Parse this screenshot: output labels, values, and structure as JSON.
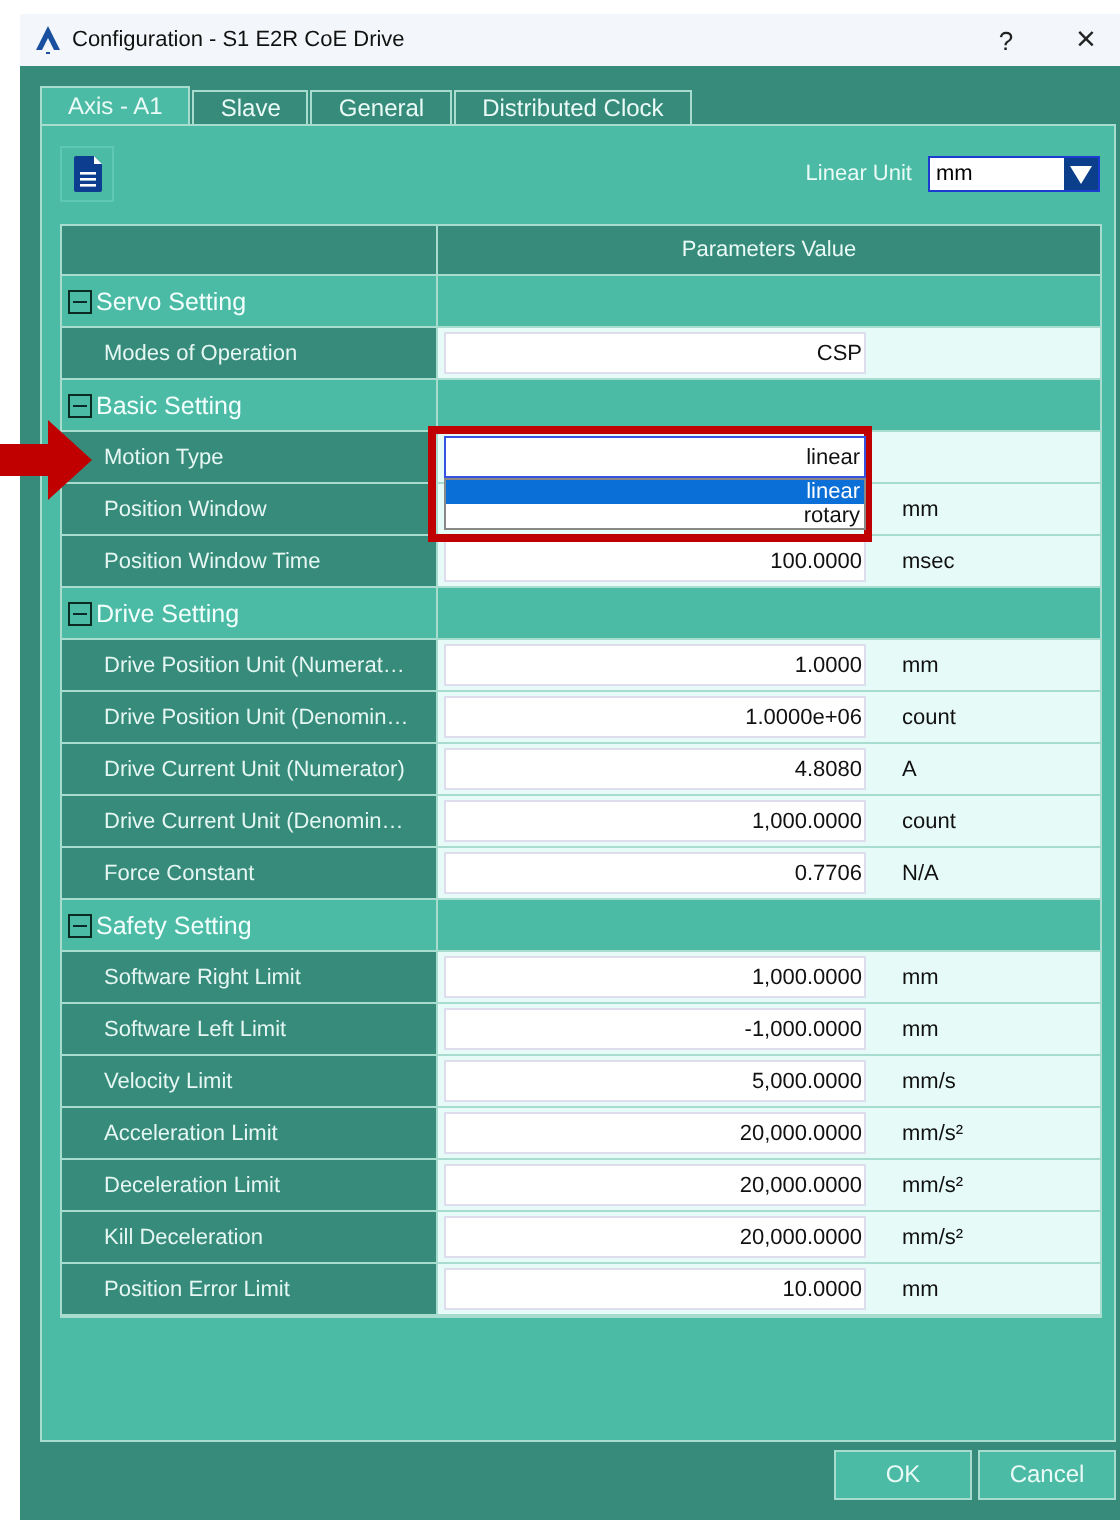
{
  "window": {
    "title": "Configuration - S1 E2R CoE Drive",
    "help": "?",
    "close": "×"
  },
  "tabs": [
    {
      "label": "Axis - A1",
      "selected": true
    },
    {
      "label": "Slave",
      "selected": false
    },
    {
      "label": "General",
      "selected": false
    },
    {
      "label": "Distributed Clock",
      "selected": false
    }
  ],
  "linear_unit": {
    "label": "Linear Unit",
    "value": "mm"
  },
  "grid": {
    "header": "Parameters Value",
    "groups": [
      {
        "title": "Servo Setting",
        "expanded": true,
        "rows": [
          {
            "name": "Modes of Operation",
            "value": "CSP"
          }
        ]
      },
      {
        "title": "Basic Setting",
        "expanded": true,
        "rows": [
          {
            "name": "Motion Type",
            "kind": "dropdown",
            "value": "linear",
            "options": [
              {
                "label": "linear",
                "selected": true
              },
              {
                "label": "rotary",
                "selected": false
              }
            ]
          },
          {
            "name": "Position Window",
            "kind": "covered",
            "unit": "mm"
          },
          {
            "name": "Position Window Time",
            "value": "100.0000",
            "unit": "msec"
          }
        ]
      },
      {
        "title": "Drive Setting",
        "expanded": true,
        "rows": [
          {
            "name": "Drive Position Unit (Numerat…",
            "value": "1.0000",
            "unit": "mm"
          },
          {
            "name": "Drive Position Unit (Denomin…",
            "value": "1.0000e+06",
            "unit": "count"
          },
          {
            "name": "Drive Current Unit (Numerator)",
            "value": "4.8080",
            "unit": "A"
          },
          {
            "name": "Drive Current Unit (Denomin…",
            "value": "1,000.0000",
            "unit": "count"
          },
          {
            "name": "Force Constant",
            "value": "0.7706",
            "unit": "N/A"
          }
        ]
      },
      {
        "title": "Safety Setting",
        "expanded": true,
        "rows": [
          {
            "name": "Software Right Limit",
            "value": "1,000.0000",
            "unit": "mm"
          },
          {
            "name": "Software Left Limit",
            "value": "-1,000.0000",
            "unit": "mm"
          },
          {
            "name": "Velocity Limit",
            "value": "5,000.0000",
            "unit": "mm/s"
          },
          {
            "name": "Acceleration Limit",
            "value": "20,000.0000",
            "unit": "mm/s²"
          },
          {
            "name": "Deceleration Limit",
            "value": "20,000.0000",
            "unit": "mm/s²"
          },
          {
            "name": "Kill Deceleration",
            "value": "20,000.0000",
            "unit": "mm/s²"
          },
          {
            "name": "Position Error Limit",
            "value": "10.0000",
            "unit": "mm"
          }
        ]
      }
    ]
  },
  "buttons": [
    "OK",
    "Cancel"
  ]
}
